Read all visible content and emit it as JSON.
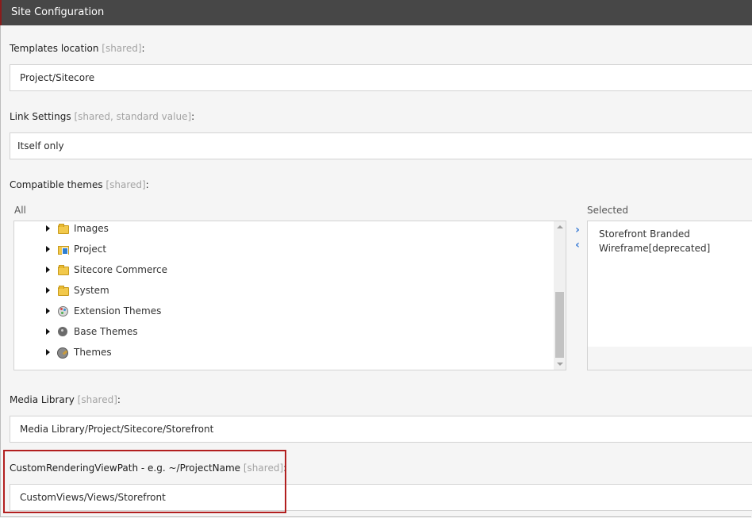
{
  "header": {
    "title": "Site Configuration"
  },
  "templates_location": {
    "label": "Templates location",
    "qualifier": "[shared]",
    "suffix": ":",
    "value": "Project/Sitecore"
  },
  "link_settings": {
    "label": "Link Settings",
    "qualifier": "[shared, standard value]",
    "suffix": ":",
    "value": "Itself only"
  },
  "compatible_themes": {
    "label": "Compatible themes",
    "qualifier": "[shared]",
    "suffix": ":",
    "all_label": "All",
    "selected_label": "Selected",
    "tree": [
      {
        "label": "Images",
        "icon": "folder-icon"
      },
      {
        "label": "Project",
        "icon": "project-folder-icon"
      },
      {
        "label": "Sitecore Commerce",
        "icon": "folder-icon"
      },
      {
        "label": "System",
        "icon": "folder-icon"
      },
      {
        "label": "Extension Themes",
        "icon": "palette-icon"
      },
      {
        "label": "Base Themes",
        "icon": "base-palette-icon"
      },
      {
        "label": "Themes",
        "icon": "themes-icon"
      }
    ],
    "move_right": "›",
    "move_left": "‹",
    "selected": [
      "Storefront Branded",
      "Wireframe[deprecated]"
    ]
  },
  "media_library": {
    "label": "Media Library",
    "qualifier": "[shared]",
    "suffix": ":",
    "value": "Media Library/Project/Sitecore/Storefront"
  },
  "custom_rendering": {
    "label": "CustomRenderingViewPath - e.g. ~/ProjectName",
    "qualifier": "[shared]",
    "suffix": ":",
    "value": "CustomViews/Views/Storefront"
  },
  "colors": {
    "header_bg": "#474747",
    "highlight": "#b21f1f",
    "accent": "#3a7bd5"
  }
}
